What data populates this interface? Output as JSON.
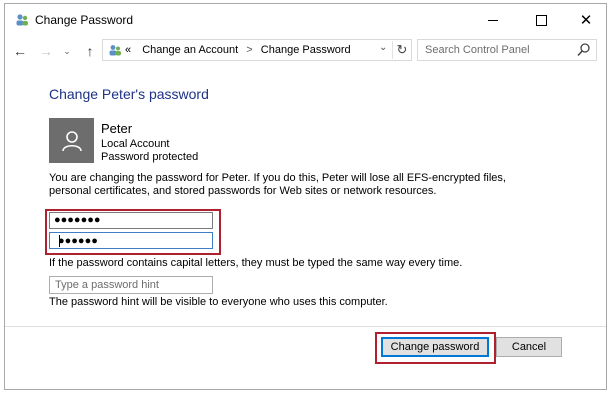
{
  "window": {
    "title": "Change Password",
    "app_icon": "users-icon",
    "controls": {
      "minimize": "minimize-icon",
      "maximize": "maximize-icon",
      "close": "✕"
    }
  },
  "nav": {
    "back": "←",
    "forward": "→",
    "recent": "⌄",
    "up": "↑",
    "address_prefix": "«",
    "breadcrumb": [
      "Change an Account",
      "Change Password"
    ],
    "separator": ">",
    "refresh": "↻",
    "search_placeholder": "Search Control Panel"
  },
  "main": {
    "heading": "Change Peter's password",
    "user": {
      "name": "Peter",
      "account_type": "Local Account",
      "status": "Password protected"
    },
    "info_text": "You are changing the password for Peter.  If you do this, Peter will lose all EFS-encrypted files, personal certificates, and stored passwords for Web sites or network resources.",
    "new_password_value": "●●●●●●●",
    "confirm_password_value": "●●●●●●",
    "caps_note": "If the password contains capital letters, they must be typed the same way every time.",
    "hint_placeholder": "Type a password hint",
    "hint_note": "The password hint will be visible to everyone who uses this computer."
  },
  "buttons": {
    "change": "Change password",
    "cancel": "Cancel"
  },
  "colors": {
    "heading": "#1e3287",
    "highlight": "#b0212f",
    "focus": "#0078d7",
    "avatar_bg": "#6d6d6d"
  }
}
